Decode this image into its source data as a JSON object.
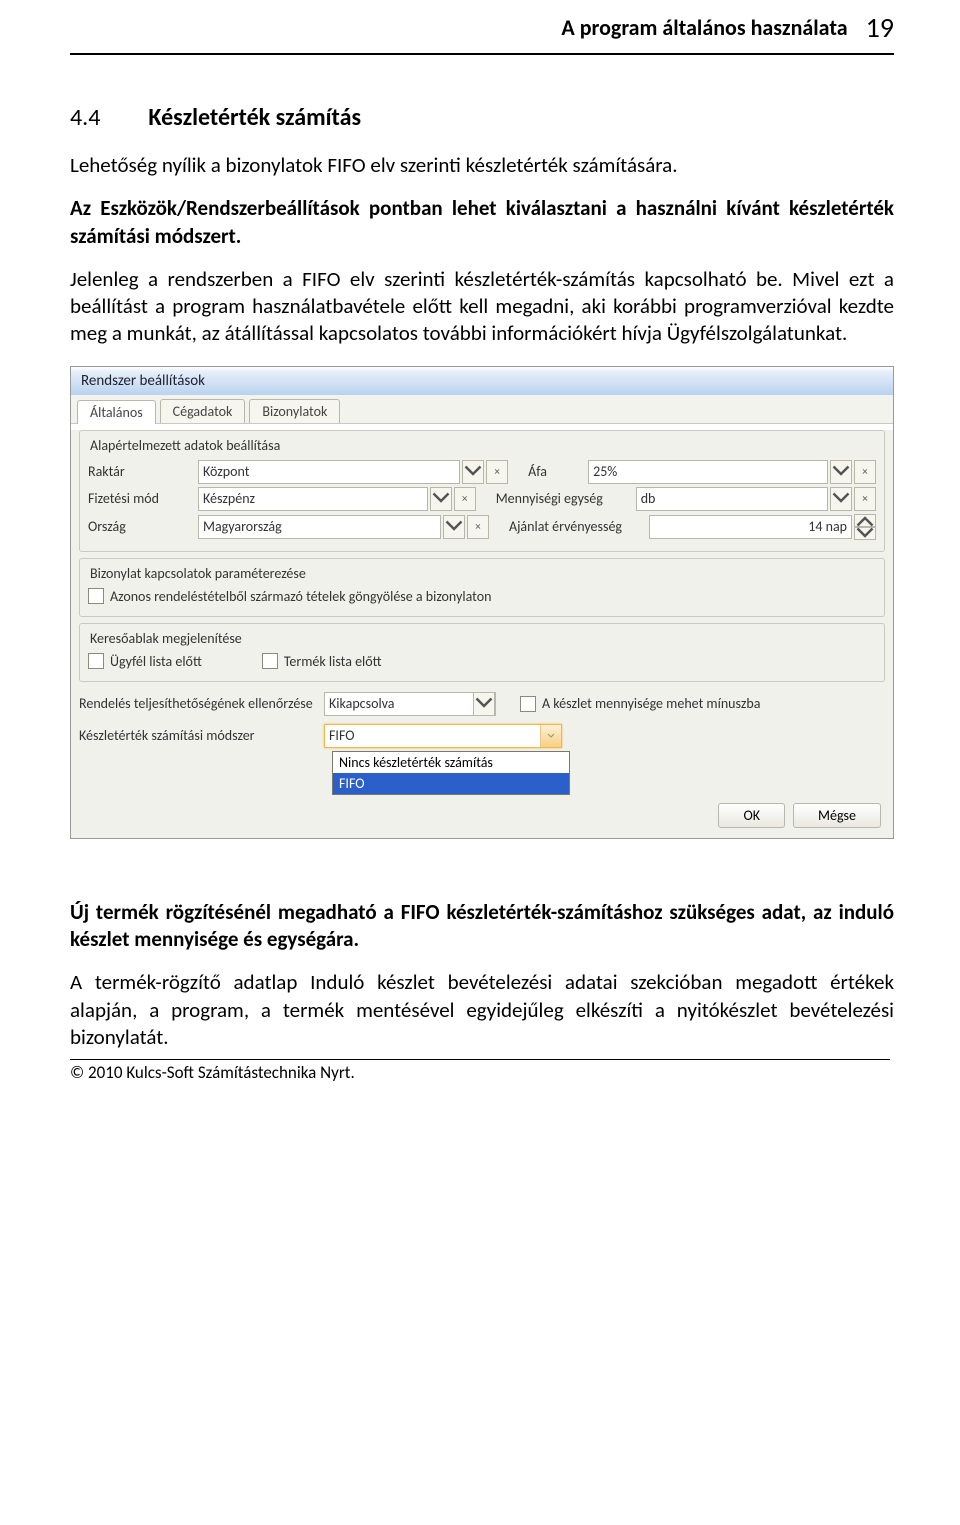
{
  "header": {
    "running_title": "A program általános használata",
    "page_number": "19"
  },
  "section": {
    "number": "4.4",
    "title": "Készletérték számítás"
  },
  "paragraphs": {
    "p1": "Lehetőség nyílik a bizonylatok FIFO elv szerinti készletérték számítására.",
    "p2": "Az Eszközök/Rendszerbeállítások pontban lehet kiválasztani a használni kívánt készletérték számítási módszert.",
    "p3": "Jelenleg a rendszerben a FIFO elv szerinti készletérték-számítás kapcsolható be. Mivel ezt a beállítást a program használatbavétele előtt kell megadni, aki korábbi programverzióval kezdte meg a munkát, az átállítással kapcsolatos további információkért hívja Ügyfélszolgálatunkat.",
    "p4": "Új termék rögzítésénél megadható a FIFO készletérték-számításhoz szükséges adat, az induló készlet mennyisége és egységára.",
    "p5": "A termék-rögzítő adatlap Induló készlet bevételezési adatai szekcióban megadott értékek alapján, a program, a termék mentésével egyidejűleg elkészíti a nyitókészlet bevételezési bizonylatát."
  },
  "window": {
    "title": "Rendszer beállítások",
    "tabs": [
      "Általános",
      "Cégadatok",
      "Bizonylatok"
    ],
    "group_defaults": {
      "title": "Alapértelmezett adatok beállítása",
      "raktar_label": "Raktár",
      "raktar_value": "Központ",
      "afa_label": "Áfa",
      "afa_value": "25%",
      "fizmod_label": "Fizetési mód",
      "fizmod_value": "Készpénz",
      "menny_label": "Mennyiségi egység",
      "menny_value": "db",
      "orszag_label": "Ország",
      "orszag_value": "Magyarország",
      "ajanlat_label": "Ajánlat érvényesség",
      "ajanlat_value": "14 nap"
    },
    "group_bizony": {
      "title": "Bizonylat kapcsolatok paraméterezése",
      "chk1": "Azonos rendeléstételből származó tételek göngyölése a bizonylaton"
    },
    "group_kereso": {
      "title": "Keresőablak megjelenítése",
      "chk1": "Ügyfél lista előtt",
      "chk2": "Termék lista előtt"
    },
    "rendeles_label": "Rendelés teljesíthetőségének ellenőrzése",
    "rendeles_value": "Kikapcsolva",
    "keszlet_minusz": "A készlet mennyisége mehet mínuszba",
    "keszletertek_label": "Készletérték számítási módszer",
    "keszletertek_value": "FIFO",
    "dropdown": {
      "opt1": "Nincs készletérték számítás",
      "opt2": "FIFO"
    },
    "buttons": {
      "ok": "OK",
      "cancel": "Mégse"
    }
  },
  "footer": "© 2010 Kulcs-Soft Számítástechnika Nyrt."
}
